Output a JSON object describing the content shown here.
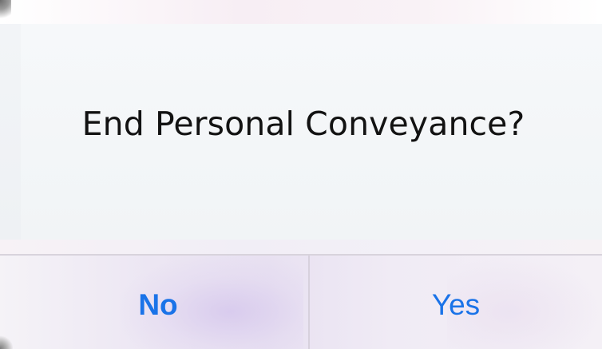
{
  "dialog": {
    "title": "End Personal Conveyance?",
    "buttons": {
      "no_label": "No",
      "yes_label": "Yes"
    }
  },
  "colors": {
    "button_text": "#1a73e8",
    "title_text": "#121212",
    "panel_background": "#f4f7f9",
    "divider": "#d8d3dc"
  }
}
